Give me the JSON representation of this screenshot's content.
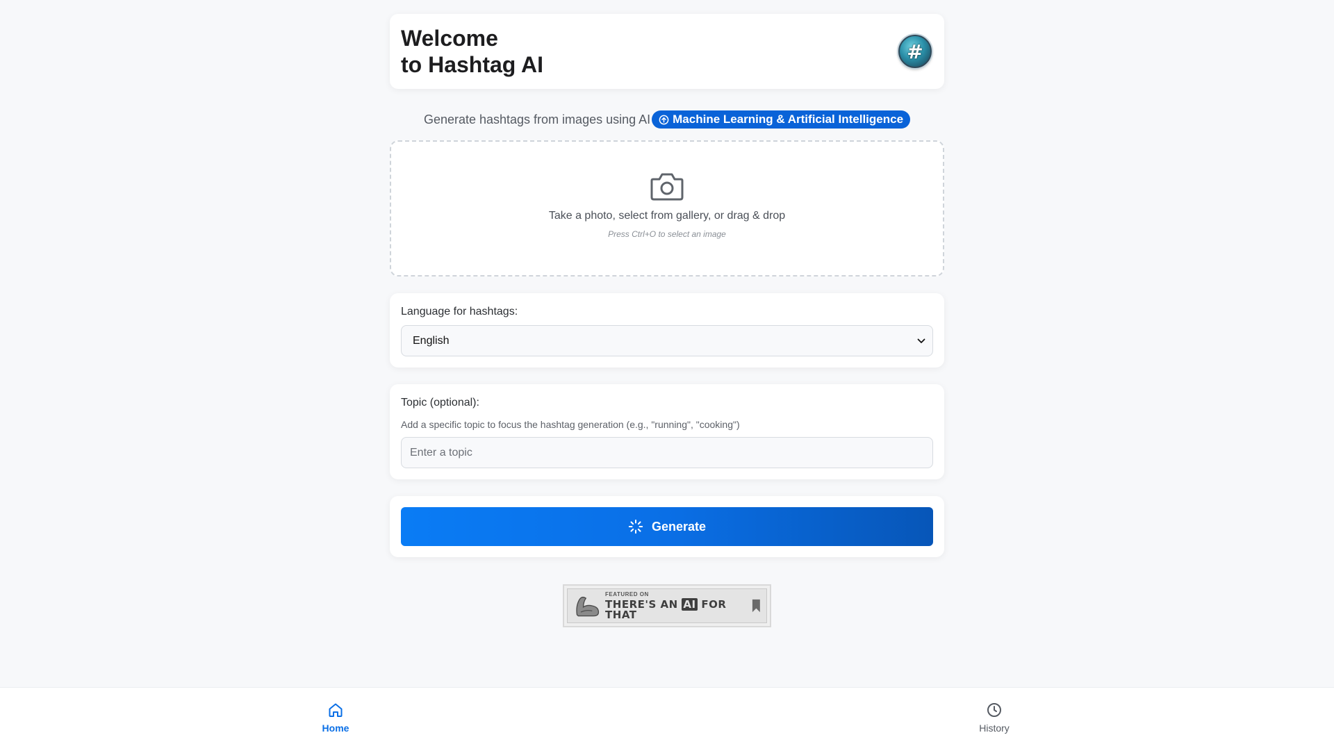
{
  "header": {
    "title_line1": "Welcome",
    "title_line2": "to Hashtag AI",
    "logo_icon": "hashtag-logo-icon",
    "logo_symbol": "#"
  },
  "subtitle": {
    "text": "Generate hashtags from images using AI",
    "badge": "Machine Learning & Artificial Intelligence"
  },
  "upload": {
    "icon": "camera-icon",
    "instruction": "Take a photo, select from gallery, or drag & drop",
    "hint": "Press Ctrl+O to select an image"
  },
  "language": {
    "label": "Language for hashtags:",
    "selected": "English"
  },
  "topic": {
    "label": "Topic (optional):",
    "description": "Add a specific topic to focus the hashtag generation (e.g., \"running\", \"cooking\")",
    "placeholder": "Enter a topic"
  },
  "generate": {
    "label": "Generate",
    "icon": "loading-spinner-icon"
  },
  "featured_badge": {
    "small": "FEATURED ON",
    "big_pre": "THERE'S AN",
    "big_ai": "AI",
    "big_post": "FOR THAT"
  },
  "nav": {
    "home": "Home",
    "history": "History"
  },
  "colors": {
    "accent": "#0a6fe6",
    "badge_bg": "#0a63d8",
    "background": "#f7f8fa"
  }
}
